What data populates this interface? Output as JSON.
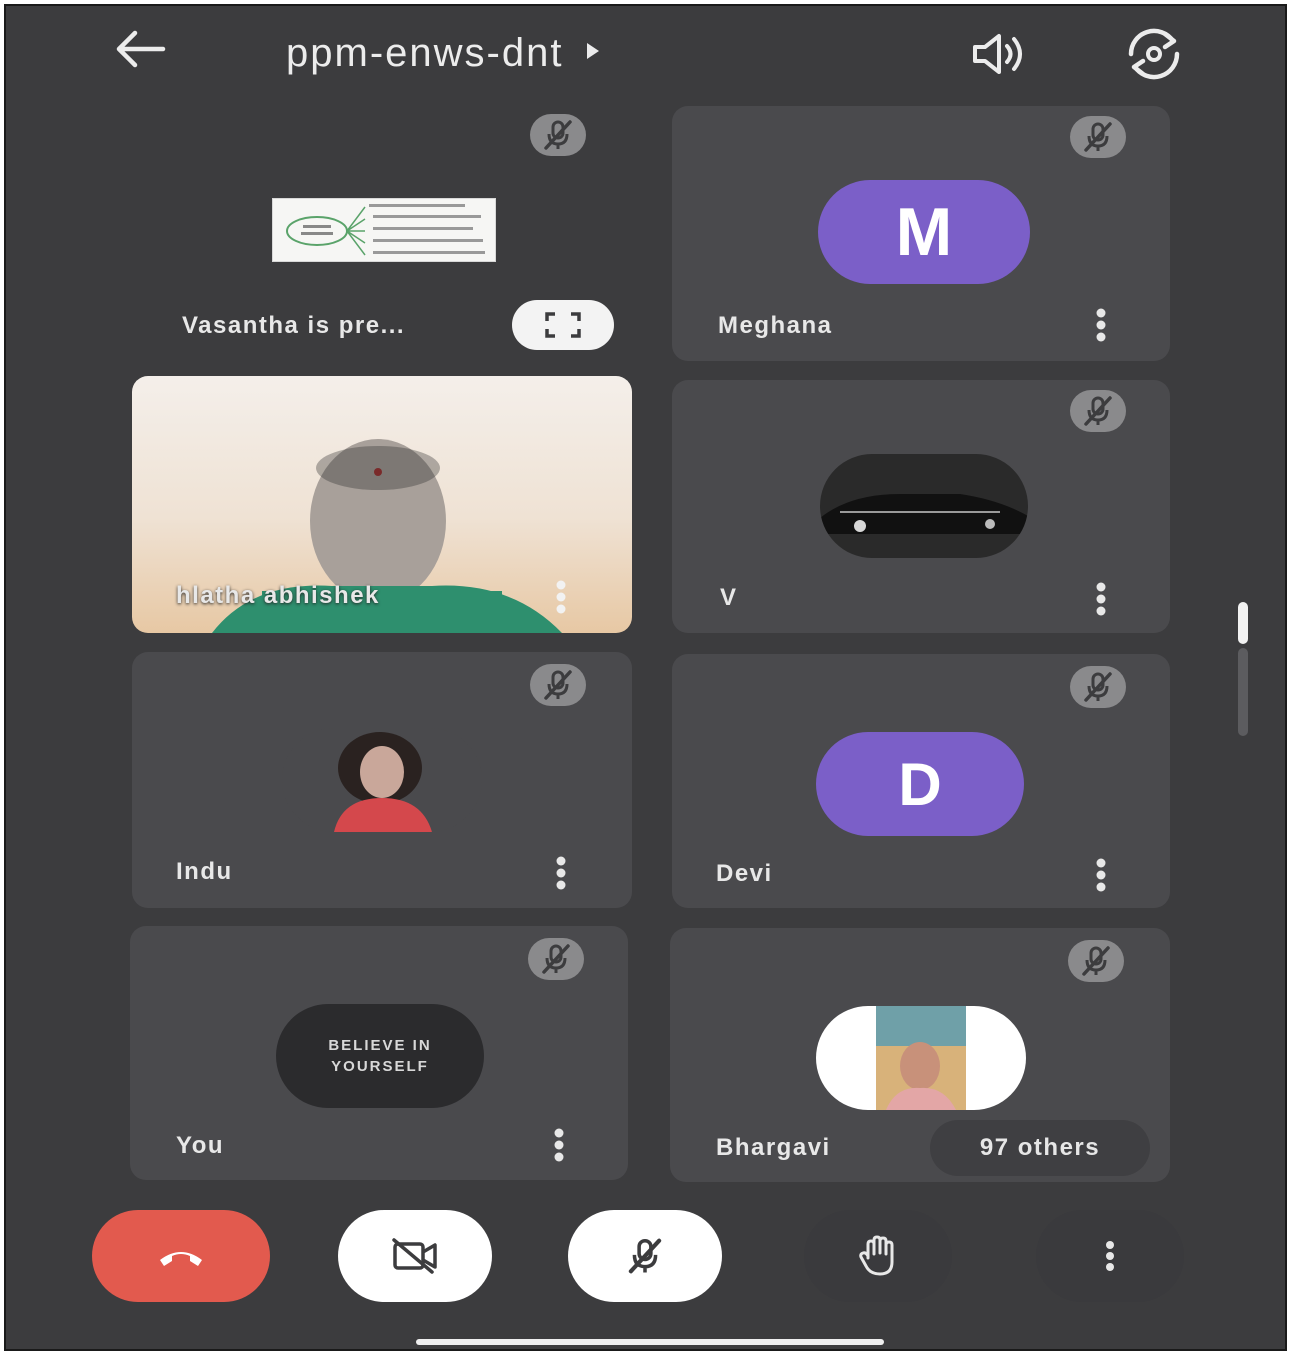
{
  "header": {
    "meeting_code": "ppm-enws-dnt",
    "back_icon": "arrow-left-icon",
    "info_icon": "caret-right-icon",
    "speaker_icon": "speaker-icon",
    "switch_camera_icon": "switch-camera-icon"
  },
  "tiles": [
    {
      "id": "presenter",
      "name": "Vasantha is pre...",
      "muted": true,
      "kind": "screen-share"
    },
    {
      "id": "meghana",
      "name": "Meghana",
      "muted": true,
      "kind": "letter-avatar",
      "initial": "M",
      "avatar_color": "#7b5fc8"
    },
    {
      "id": "hlatha",
      "name": "hlatha abhishek",
      "muted": false,
      "kind": "video"
    },
    {
      "id": "v",
      "name": "V",
      "muted": true,
      "kind": "photo-avatar"
    },
    {
      "id": "indu",
      "name": "Indu",
      "muted": true,
      "kind": "photo-avatar"
    },
    {
      "id": "devi",
      "name": "Devi",
      "muted": true,
      "kind": "letter-avatar",
      "initial": "D",
      "avatar_color": "#7b5fc8"
    },
    {
      "id": "you",
      "name": "You",
      "muted": true,
      "kind": "photo-avatar",
      "avatar_text_line1": "BELIEVE IN",
      "avatar_text_line2": "YOURSELF"
    },
    {
      "id": "bhargavi",
      "name": "Bhargavi",
      "muted": true,
      "kind": "photo-avatar"
    }
  ],
  "others_label": "97 others",
  "controls": {
    "end_call_color": "#e25a4e",
    "end_call_icon": "phone-hangup-icon",
    "camera_icon": "camera-off-icon",
    "mic_icon": "mic-off-icon",
    "raise_hand_icon": "hand-icon",
    "more_icon": "more-vertical-icon"
  }
}
